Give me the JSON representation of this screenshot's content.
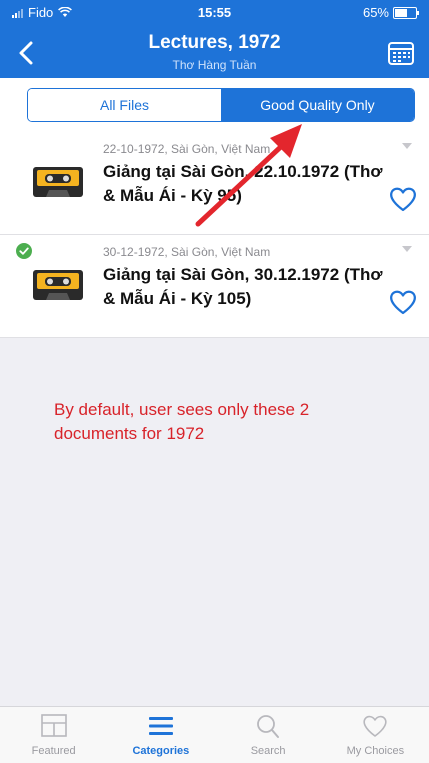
{
  "status_bar": {
    "carrier": "Fido",
    "time": "15:55",
    "battery": "65%",
    "battery_level": 0.65
  },
  "header": {
    "title": "Lectures, 1972",
    "subtitle": "Thơ Hàng Tuần"
  },
  "segmented": {
    "all_files": "All Files",
    "good_quality": "Good Quality Only",
    "selected": "Good Quality Only"
  },
  "items": [
    {
      "meta": "22-10-1972, Sài Gòn, Việt Nam",
      "title": "Giảng tại Sài Gòn, 22.10.1972 (Thơ & Mẫu Ái - Kỳ 95)",
      "downloaded": false
    },
    {
      "meta": "30-12-1972, Sài Gòn, Việt Nam",
      "title": "Giảng tại Sài Gòn, 30.12.1972 (Thơ & Mẫu Ái - Kỳ 105)",
      "downloaded": true
    }
  ],
  "annotation": "By default, user sees only these 2 documents for 1972",
  "tabbar": {
    "featured": "Featured",
    "categories": "Categories",
    "search": "Search",
    "my_choices": "My Choices",
    "active": "Categories"
  },
  "colors": {
    "accent": "#1e73d8",
    "annotation": "#d8232a",
    "check": "#4cae4f"
  }
}
